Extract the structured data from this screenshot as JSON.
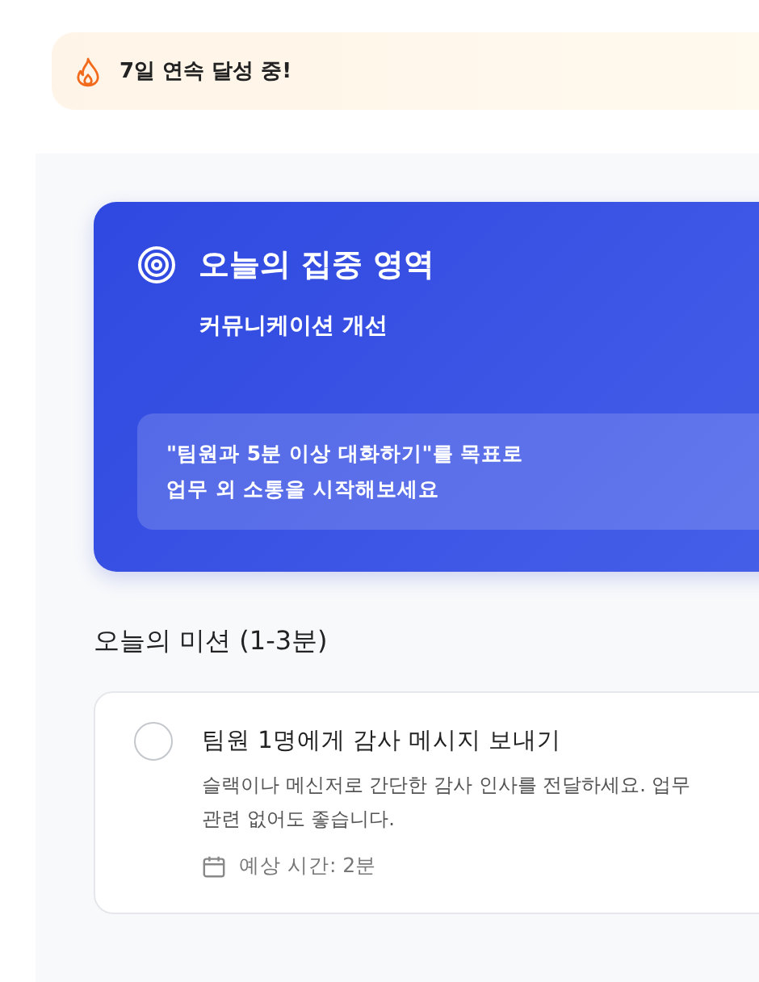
{
  "streak_banner": {
    "text": "7일 연속 달성 중!"
  },
  "focus_card": {
    "title": "오늘의 집중 영역",
    "subtitle": "커뮤니케이션 개선",
    "tip_lines": [
      "\"팀원과 5분 이상 대화하기\"를 목표로",
      "업무 외 소통을 시작해보세요"
    ]
  },
  "missions_heading": "오늘의 미션 (1-3분)",
  "missions": [
    {
      "title": "팀원 1명에게 감사 메시지 보내기",
      "description_lines": [
        "슬랙이나 메신저로 간단한 감사 인사를 전달하세요. 업무",
        "관련 없어도 좋습니다."
      ],
      "time": "예상 시간: 2분",
      "checked": false
    }
  ]
}
